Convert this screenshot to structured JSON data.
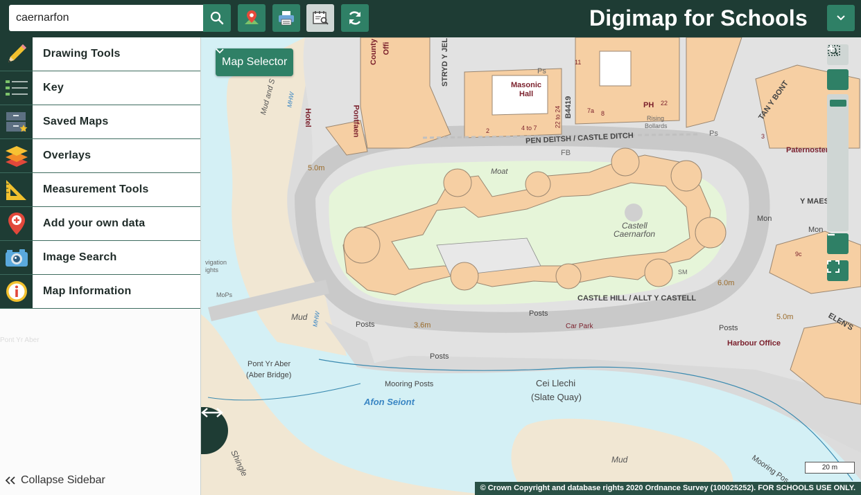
{
  "header": {
    "search_value": "caernarfon",
    "title": "Digimap for Schools",
    "buttons": [
      "search-icon",
      "map-pin-icon",
      "printer-icon",
      "save-map-icon",
      "refresh-icon"
    ]
  },
  "sidebar": {
    "items": [
      {
        "label": "Drawing Tools",
        "icon": "pencil-icon"
      },
      {
        "label": "Key",
        "icon": "key-list-icon"
      },
      {
        "label": "Saved Maps",
        "icon": "saved-maps-icon"
      },
      {
        "label": "Overlays",
        "icon": "layers-icon"
      },
      {
        "label": "Measurement Tools",
        "icon": "ruler-triangle-icon"
      },
      {
        "label": "Add your own data",
        "icon": "location-add-icon"
      },
      {
        "label": "Image Search",
        "icon": "camera-icon"
      },
      {
        "label": "Map Information",
        "icon": "info-icon"
      }
    ],
    "collapse_label": "Collapse Sidebar"
  },
  "map": {
    "selector_label": "Map Selector",
    "scale_label": "20 m",
    "copyright": "© Crown Copyright and database rights 2020 Ordnance Survey (100025252). FOR SCHOOLS USE ONLY.",
    "labels": {
      "castle": "Castell",
      "castle2": "Caernarfon",
      "castle_ditch": "PEN DEITSH / CASTLE DITCH",
      "castle_hill": "CASTLE HILL / ALLT Y CASTELL",
      "masonic": "Masonic",
      "masonic2": "Hall",
      "moat": "Moat",
      "mud1": "Mud",
      "mud2": "Mud",
      "mud3": "Mud and S",
      "car_park": "Car Park",
      "harbour": "Harbour Office",
      "paternoster": "Paternoster",
      "aber": "Pont Yr Aber",
      "aber2": "(Aber Bridge)",
      "cei": "Cei Llechi",
      "cei2": "(Slate Quay)",
      "afon": "Afon Seiont",
      "mooring": "Mooring Posts",
      "mooring2": "Mooring Pos",
      "posts1": "Posts",
      "posts2": "Posts",
      "posts3": "Posts",
      "posts4": "Posts",
      "shingle": "Shingle",
      "hotel": "Hotel",
      "pontfaen": "Pontfaen",
      "b4419": "B4419",
      "ph": "PH",
      "mon1": "Mon",
      "mon2": "Mon",
      "y_maes": "Y MAES",
      "spot1": "5.0m",
      "spot2": "6.0m",
      "spot3": "5.0m",
      "spot4": "3.6m",
      "rising": "Rising",
      "bollards": "Bollards",
      "mops": "MoPs",
      "nav1": "vigation",
      "nav2": "ights",
      "stryd": "STRYD Y JEL",
      "county": "County",
      "offi": "Offi",
      "tan_y_bont": "TAN Y BONT",
      "elen": "ELEN'S",
      "ps1": "Ps",
      "ps2": "Ps",
      "fb": "FB",
      "mhw1": "MHW",
      "mhw2": "MHW",
      "sm": "SM",
      "pont_aber_faint": "Pont Yr Aber",
      "n11": "11",
      "n7a": "7a",
      "n8": "8",
      "n22": "22",
      "n2": "2",
      "n4to7": "4 to 7",
      "n22to24": "22 to 24",
      "n3": "3",
      "n9c": "9c"
    }
  }
}
